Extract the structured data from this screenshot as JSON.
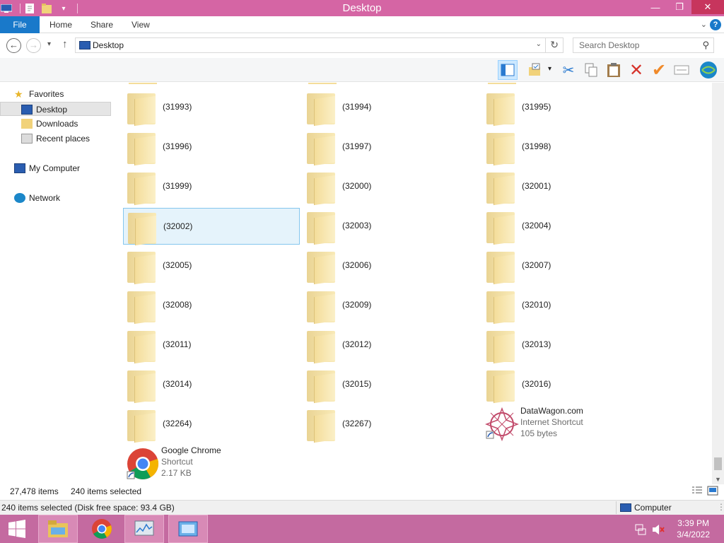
{
  "window": {
    "title": "Desktop"
  },
  "ribbon": {
    "file": "File",
    "tabs": [
      "Home",
      "Share",
      "View"
    ],
    "help": "?"
  },
  "address": {
    "path": "Desktop",
    "search_placeholder": "Search Desktop"
  },
  "navpane": {
    "favorites": "Favorites",
    "items": [
      "Desktop",
      "Downloads",
      "Recent places"
    ],
    "computer": "My Computer",
    "network": "Network"
  },
  "folders": [
    [
      "(31993)",
      "(31994)",
      "(31995)"
    ],
    [
      "(31996)",
      "(31997)",
      "(31998)"
    ],
    [
      "(31999)",
      "(32000)",
      "(32001)"
    ],
    [
      "(32002)",
      "(32003)",
      "(32004)"
    ],
    [
      "(32005)",
      "(32006)",
      "(32007)"
    ],
    [
      "(32008)",
      "(32009)",
      "(32010)"
    ],
    [
      "(32011)",
      "(32012)",
      "(32013)"
    ],
    [
      "(32014)",
      "(32015)",
      "(32016)"
    ],
    [
      "(32264)",
      "(32267)"
    ]
  ],
  "shortcuts": {
    "datawagon": {
      "name": "DataWagon.com",
      "type": "Internet Shortcut",
      "size": "105 bytes"
    },
    "chrome": {
      "name": "Google Chrome",
      "type": "Shortcut",
      "size": "2.17 KB"
    }
  },
  "status": {
    "items": "27,478 items",
    "selected": "240 items selected"
  },
  "details": {
    "text": "240 items selected (Disk free space: 93.4 GB)",
    "location": "Computer"
  },
  "clock": {
    "time": "3:39 PM",
    "date": "3/4/2022"
  },
  "colors": {
    "titlebar": "#d565a4",
    "taskbar": "#c46aa0",
    "file_tab": "#1979ca",
    "selection": "#e5f3fb"
  }
}
